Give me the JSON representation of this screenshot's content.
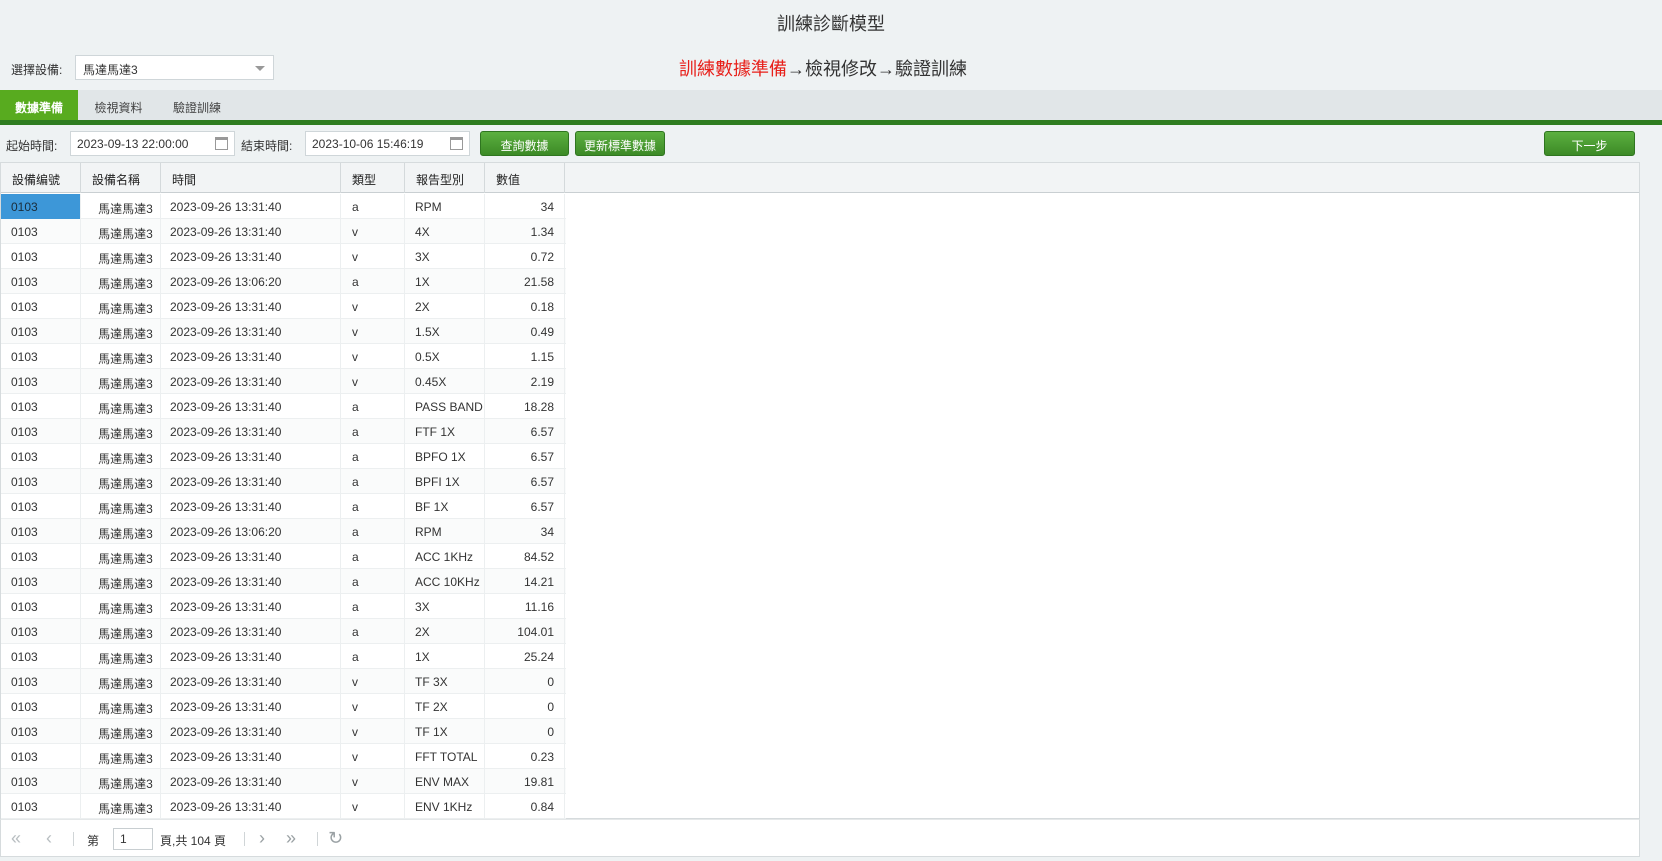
{
  "header": {
    "title": "訓練診斷模型"
  },
  "device": {
    "label": "選擇設備:",
    "selected": "馬達馬達3"
  },
  "steps": {
    "current": "訓練數據準備",
    "arrow1": "→",
    "step2": "檢視修改",
    "arrow2": "→",
    "step3": "驗證訓練"
  },
  "tabs": [
    "數據準備",
    "檢視資料",
    "驗證訓練"
  ],
  "toolbar": {
    "start_label": "起始時間:",
    "start_value": "2023-09-13 22:00:00",
    "end_label": "結束時間:",
    "end_value": "2023-10-06 15:46:19",
    "query_label": "查詢數據",
    "update_label": "更新標準數據",
    "next_label": "下一步"
  },
  "table": {
    "columns": [
      "設備编號",
      "設備名稱",
      "時間",
      "類型",
      "報告型別",
      "數值"
    ],
    "rows": [
      [
        "0103",
        "馬達馬達3",
        "2023-09-26 13:31:40",
        "a",
        "RPM",
        "34"
      ],
      [
        "0103",
        "馬達馬達3",
        "2023-09-26 13:31:40",
        "v",
        "4X",
        "1.34"
      ],
      [
        "0103",
        "馬達馬達3",
        "2023-09-26 13:31:40",
        "v",
        "3X",
        "0.72"
      ],
      [
        "0103",
        "馬達馬達3",
        "2023-09-26 13:06:20",
        "a",
        "1X",
        "21.58"
      ],
      [
        "0103",
        "馬達馬達3",
        "2023-09-26 13:31:40",
        "v",
        "2X",
        "0.18"
      ],
      [
        "0103",
        "馬達馬達3",
        "2023-09-26 13:31:40",
        "v",
        "1.5X",
        "0.49"
      ],
      [
        "0103",
        "馬達馬達3",
        "2023-09-26 13:31:40",
        "v",
        "0.5X",
        "1.15"
      ],
      [
        "0103",
        "馬達馬達3",
        "2023-09-26 13:31:40",
        "v",
        "0.45X",
        "2.19"
      ],
      [
        "0103",
        "馬達馬達3",
        "2023-09-26 13:31:40",
        "a",
        "PASS BAND",
        "18.28"
      ],
      [
        "0103",
        "馬達馬達3",
        "2023-09-26 13:31:40",
        "a",
        "FTF 1X",
        "6.57"
      ],
      [
        "0103",
        "馬達馬達3",
        "2023-09-26 13:31:40",
        "a",
        "BPFO 1X",
        "6.57"
      ],
      [
        "0103",
        "馬達馬達3",
        "2023-09-26 13:31:40",
        "a",
        "BPFI 1X",
        "6.57"
      ],
      [
        "0103",
        "馬達馬達3",
        "2023-09-26 13:31:40",
        "a",
        "BF 1X",
        "6.57"
      ],
      [
        "0103",
        "馬達馬達3",
        "2023-09-26 13:06:20",
        "a",
        "RPM",
        "34"
      ],
      [
        "0103",
        "馬達馬達3",
        "2023-09-26 13:31:40",
        "a",
        "ACC 1KHz",
        "84.52"
      ],
      [
        "0103",
        "馬達馬達3",
        "2023-09-26 13:31:40",
        "a",
        "ACC 10KHz",
        "14.21"
      ],
      [
        "0103",
        "馬達馬達3",
        "2023-09-26 13:31:40",
        "a",
        "3X",
        "11.16"
      ],
      [
        "0103",
        "馬達馬達3",
        "2023-09-26 13:31:40",
        "a",
        "2X",
        "104.01"
      ],
      [
        "0103",
        "馬達馬達3",
        "2023-09-26 13:31:40",
        "a",
        "1X",
        "25.24"
      ],
      [
        "0103",
        "馬達馬達3",
        "2023-09-26 13:31:40",
        "v",
        "TF 3X",
        "0"
      ],
      [
        "0103",
        "馬達馬達3",
        "2023-09-26 13:31:40",
        "v",
        "TF 2X",
        "0"
      ],
      [
        "0103",
        "馬達馬達3",
        "2023-09-26 13:31:40",
        "v",
        "TF 1X",
        "0"
      ],
      [
        "0103",
        "馬達馬達3",
        "2023-09-26 13:31:40",
        "v",
        "FFT TOTAL",
        "0.23"
      ],
      [
        "0103",
        "馬達馬達3",
        "2023-09-26 13:31:40",
        "v",
        "ENV MAX",
        "19.81"
      ],
      [
        "0103",
        "馬達馬達3",
        "2023-09-26 13:31:40",
        "v",
        "ENV 1KHz",
        "0.84"
      ]
    ]
  },
  "pager": {
    "first_icon": "double-chevron-left-icon",
    "prev_icon": "chevron-left-icon",
    "next_icon": "chevron-right-icon",
    "last_icon": "double-chevron-right-icon",
    "refresh_icon": "refresh-icon",
    "page_prefix": "第",
    "page_value": "1",
    "page_suffix": "頁,共 104 頁"
  },
  "colors": {
    "accent_green": "#58ab1f",
    "tab_border": "#2f7d20",
    "step_red": "#e8201a",
    "selected_cell": "#3d97d8"
  }
}
